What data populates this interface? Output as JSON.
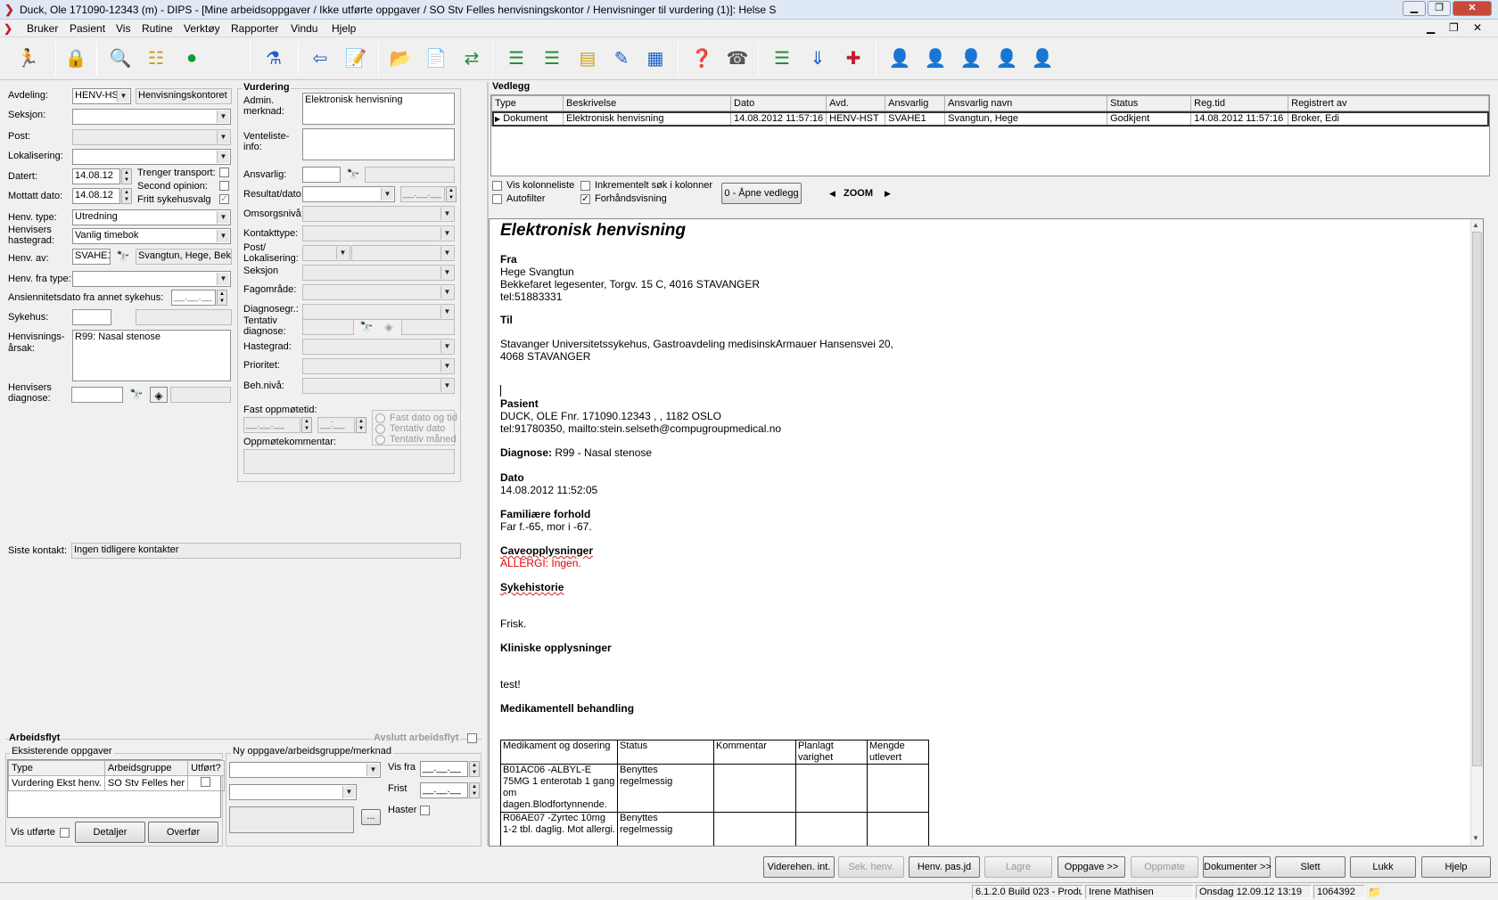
{
  "window": {
    "title": "Duck, Ole  171090-12343 (m) - DIPS - [Mine arbeidsoppgaver / Ikke utførte oppgaver / SO Stv Felles henvisningskontor / Henvisninger til vurdering (1)]: Helse S"
  },
  "menu": [
    "Bruker",
    "Pasient",
    "Vis",
    "Rutine",
    "Verktøy",
    "Rapporter",
    "Vindu",
    "Hjelp"
  ],
  "left": {
    "avdeling_label": "Avdeling:",
    "avdeling_value": "HENV-HS",
    "avdeling_name": "Henvisningskontoret",
    "seksjon_label": "Seksjon:",
    "post_label": "Post:",
    "lokalisering_label": "Lokalisering:",
    "datert_label": "Datert:",
    "datert_value": "14.08.12",
    "mottatt_label": "Mottatt dato:",
    "mottatt_value": "14.08.12",
    "trenger_transport": "Trenger transport:",
    "second_opinion": "Second opinion:",
    "fritt_sykehusvalg": "Fritt sykehusvalg",
    "henv_type_label": "Henv. type:",
    "henv_type_value": "Utredning",
    "hastegrad_label": "Henvisers hastegrad:",
    "hastegrad_value": "Vanlig timebok",
    "henv_av_label": "Henv. av:",
    "henv_av_code": "SVAHE1",
    "henv_av_name": "Svangtun, Hege, Bek",
    "henv_fra_type_label": "Henv. fra type:",
    "ansiennitet_label": "Ansiennitetsdato fra annet sykehus:",
    "date_placeholder": "__.__.__",
    "sykehus_label": "Sykehus:",
    "arsak_label": "Henvisnings-årsak:",
    "arsak_value": "R99: Nasal stenose",
    "diagnose_label": "Henvisers diagnose:",
    "siste_kontakt_label": "Siste kontakt:",
    "siste_kontakt_value": "Ingen tidligere kontakter"
  },
  "vurdering": {
    "title": "Vurdering",
    "admin_label": "Admin. merknad:",
    "admin_value": "Elektronisk henvisning",
    "venteliste_label": "Venteliste-info:",
    "ansvarlig_label": "Ansvarlig:",
    "resultat_label": "Resultat/dato:",
    "omsorgsniva_label": "Omsorgsnivå:",
    "kontakttype_label": "Kontakttype:",
    "post_lok_label": "Post/ Lokalisering:",
    "seksjon_label": "Seksjon",
    "fagomrade_label": "Fagområde:",
    "diagnosegr_label": "Diagnosegr.:",
    "tentativ_label": "Tentativ diagnose:",
    "hastegrad_label": "Hastegrad:",
    "prioritet_label": "Prioritet:",
    "behniva_label": "Beh.nivå:",
    "fast_label": "Fast oppmøtetid:",
    "time_placeholder": "__:__",
    "radio_fast": "Fast dato og tid",
    "radio_tentativ_dato": "Tentativ dato",
    "radio_tentativ_maned": "Tentativ måned",
    "oppmote_label": "Oppmøtekommentar:"
  },
  "arbeidsflyt": {
    "title": "Arbeidsflyt",
    "avslutt": "Avslutt arbeidsflyt",
    "eksisterende": "Eksisterende oppgaver",
    "columns": [
      "Type",
      "Arbeidsgruppe",
      "Utført?"
    ],
    "rows": [
      [
        "Vurdering Ekst henv.",
        "SO Stv Felles her"
      ]
    ],
    "ny_label": "Ny oppgave/arbeidsgruppe/merknad",
    "vis_fra": "Vis fra",
    "frist": "Frist",
    "haster": "Haster",
    "vis_utforte": "Vis utførte",
    "detaljer": "Detaljer",
    "overfor": "Overfør",
    "ellipsis": "..."
  },
  "vedlegg": {
    "title": "Vedlegg",
    "columns": [
      "Type",
      "Beskrivelse",
      "Dato",
      "Avd.",
      "Ansvarlig",
      "Ansvarlig navn",
      "Status",
      "Reg.tid",
      "Registrert av"
    ],
    "rows": [
      [
        "Dokument",
        "Elektronisk henvisning",
        "14.08.2012 11:57:16",
        "HENV-HST",
        "SVAHE1",
        "Svangtun, Hege",
        "Godkjent",
        "14.08.2012 11:57:16",
        "Broker, Edi"
      ]
    ],
    "vis_kolonneliste": "Vis kolonneliste",
    "autofilter": "Autofilter",
    "inkrementelt": "Inkrementelt søk i kolonner",
    "forhandsvisning": "Forhåndsvisning",
    "apne": "0 - Åpne vedlegg",
    "zoom": "ZOOM"
  },
  "document": {
    "heading": "Elektronisk henvisning",
    "fra": "Fra",
    "fra_name": "Hege Svangtun",
    "fra_addr": "Bekkefaret legesenter,  Torgv. 15 C,  4016 STAVANGER",
    "fra_tel": "tel:51883331",
    "til": "Til",
    "til_addr1": "Stavanger Universitetssykehus,  Gastroavdeling medisinskArmauer Hansensvei 20,",
    "til_addr2": " 4068 STAVANGER",
    "pasient": "Pasient",
    "pasient_line1": "DUCK, OLE  Fnr. 171090.12343 , ,  1182 OSLO",
    "pasient_line2": "tel:91780350,  mailto:stein.selseth@compugroupmedical.no",
    "diagnose_label": "Diagnose: ",
    "diagnose_value": "R99 - Nasal stenose",
    "dato": "Dato",
    "dato_value": "14.08.2012 11:52:05",
    "familiaere": "Familiære forhold",
    "familiaere_value": "Far f.-65, mor i -67.",
    "cave": "Caveopplysninger",
    "cave_value": " ALLERGI: Ingen.",
    "sykehistorie": "Sykehistorie",
    "frisk": "Frisk.",
    "kliniske": "Kliniske opplysninger",
    "test": "test!",
    "medikamentell": "Medikamentell behandling",
    "med_columns": [
      "Medikament og dosering",
      "Status",
      "Kommentar",
      "Planlagt varighet",
      "Mengde utlevert"
    ],
    "med_rows": [
      [
        "B01AC06 -ALBYL-E 75MG  1 enterotab 1 gang om dagen.Blodfortynnende.",
        "Benyttes regelmessig"
      ],
      [
        "R06AE07 -Zyrtec 10mg  1-2 tbl. daglig. Mot allergi.",
        "Benyttes regelmessig"
      ]
    ]
  },
  "buttons": [
    "Viderehen. int.",
    "Sek. henv.",
    "Henv. pas.jd",
    "Lagre",
    "Oppgave >>",
    "Oppmøte",
    "Dokumenter >>",
    "Slett",
    "Lukk",
    "Hjelp"
  ],
  "status": {
    "build": "6.1.2.0 Build 023 - Produ",
    "user": "Irene Mathisen",
    "datetime": "Onsdag 12.09.12 13:19",
    "id": "1064392"
  }
}
